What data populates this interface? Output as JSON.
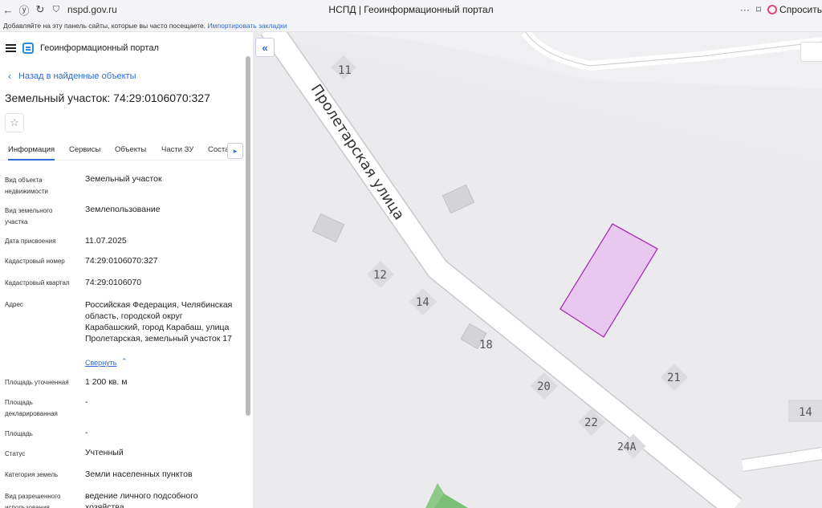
{
  "browser": {
    "url": "nspd.gov.ru",
    "tab_title": "НСПД | Геоинформационный портал",
    "more": "···",
    "ask_label": "Спросить",
    "bookmarks_text": "Добавляйте на эту панель сайты, которые вы часто посещаете.",
    "bookmarks_link": "Импортировать закладки"
  },
  "app": {
    "title": "Геоинформационный портал",
    "back_link": "Назад в найденные объекты",
    "object_title": "Земельный участок: 74:29:0106070:327"
  },
  "tabs": [
    "Информация",
    "Сервисы",
    "Объекты",
    "Части ЗУ",
    "Соста"
  ],
  "properties": [
    {
      "label": "Вид объекта недвижимости",
      "value": "Земельный участок"
    },
    {
      "label": "Вид земельного участка",
      "value": "Землепользование"
    },
    {
      "label": "Дата присвоения",
      "value": "11.07.2025"
    },
    {
      "label": "Кадастровый номер",
      "value": "74:29:0106070:327"
    },
    {
      "label": "Кадастровый квартал",
      "value": "74:29:0106070"
    },
    {
      "label": "Адрес",
      "value": "Российская Федерация, Челябинская область, городской округ Карабашский, город Карабаш, улица Пролетарская, земельный участок 17"
    },
    {
      "label": "Площадь уточненная",
      "value": "1 200 кв. м"
    },
    {
      "label": "Площадь декларированная",
      "value": "-"
    },
    {
      "label": "Площадь",
      "value": "-"
    },
    {
      "label": "Статус",
      "value": "Учтенный"
    },
    {
      "label": "Категория земель",
      "value": "Земли населенных пунктов"
    },
    {
      "label": "Вид разрешенного использования",
      "value": "ведение личного подсобного хозяйства"
    }
  ],
  "collapse_label": "Свернуть",
  "map": {
    "street_name": "Пролетарская улица",
    "house_numbers": [
      "11",
      "12",
      "14",
      "18",
      "20",
      "21",
      "22",
      "24А",
      "14"
    ],
    "parcel_fill": "#e8c8ee",
    "parcel_stroke": "#a630b8"
  }
}
